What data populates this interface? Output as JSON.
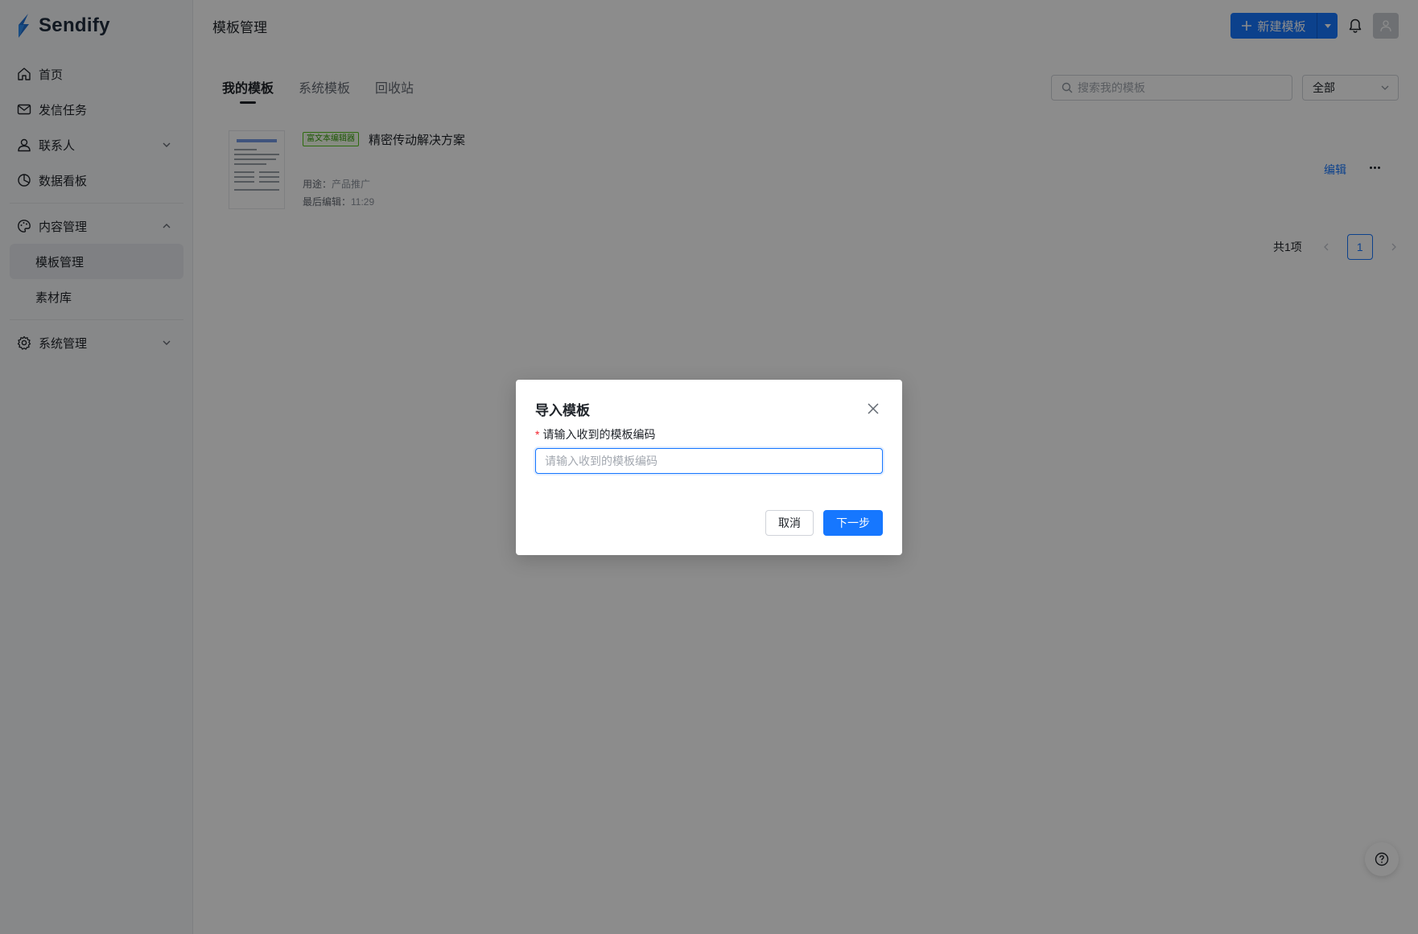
{
  "brand": {
    "name": "Sendify",
    "color": "#1f6fd1"
  },
  "sidebar": {
    "items": [
      {
        "label": "首页",
        "icon": "home-icon"
      },
      {
        "label": "发信任务",
        "icon": "mail-icon"
      },
      {
        "label": "联系人",
        "icon": "user-icon",
        "expandable": true
      },
      {
        "label": "数据看板",
        "icon": "pie-chart-icon"
      },
      {
        "label": "内容管理",
        "icon": "palette-icon",
        "expanded": true
      },
      {
        "label": "系统管理",
        "icon": "gear-icon",
        "expandable": true
      }
    ],
    "sub_items": [
      {
        "label": "模板管理",
        "active": true
      },
      {
        "label": "素材库"
      }
    ]
  },
  "header": {
    "title": "模板管理",
    "new_button": "新建模板"
  },
  "tabs": [
    {
      "label": "我的模板",
      "active": true
    },
    {
      "label": "系统模板"
    },
    {
      "label": "回收站"
    }
  ],
  "search": {
    "placeholder": "搜索我的模板"
  },
  "filter": {
    "value": "全部"
  },
  "templates": [
    {
      "badge": "富文本编辑器",
      "name": "精密传动解决方案",
      "purpose_label": "用途：",
      "purpose": "产品推广",
      "edited_label": "最后编辑：",
      "edited": "11:29",
      "edit_label": "编辑"
    }
  ],
  "pagination": {
    "total": "共1项",
    "current": "1"
  },
  "modal": {
    "title": "导入模板",
    "field_label": "请输入收到的模板编码",
    "required_mark": "*",
    "input_value": "",
    "input_placeholder": "请输入收到的模板编码",
    "cancel": "取消",
    "next": "下一步"
  },
  "colors": {
    "primary": "#1677ff",
    "badge_green": "#52c41a",
    "overlay": "rgba(0,0,0,0.45)"
  }
}
